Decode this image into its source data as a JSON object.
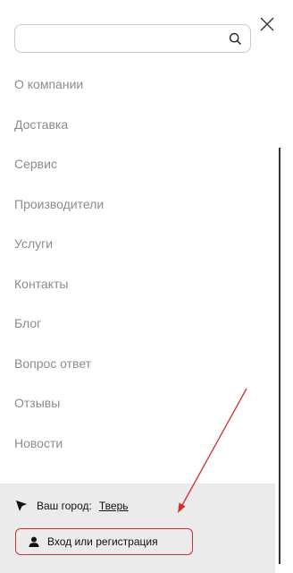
{
  "search": {
    "value": "",
    "placeholder": ""
  },
  "menu": {
    "items": [
      {
        "label": "О компании"
      },
      {
        "label": "Доставка"
      },
      {
        "label": "Сервис"
      },
      {
        "label": "Производители"
      },
      {
        "label": "Услуги"
      },
      {
        "label": "Контакты"
      },
      {
        "label": "Блог"
      },
      {
        "label": "Вопрос ответ"
      },
      {
        "label": "Отзывы"
      },
      {
        "label": "Новости"
      }
    ]
  },
  "city": {
    "label": "Ваш город:",
    "value": "Тверь"
  },
  "login": {
    "label": "Вход или регистрация"
  },
  "icons": {
    "close": "close-icon",
    "search": "search-icon",
    "location": "cursor-arrow-icon",
    "user": "user-icon"
  },
  "colors": {
    "text_muted": "#8c8c8c",
    "panel_bg": "#ebebeb",
    "annotation_red": "#d32f2f"
  }
}
